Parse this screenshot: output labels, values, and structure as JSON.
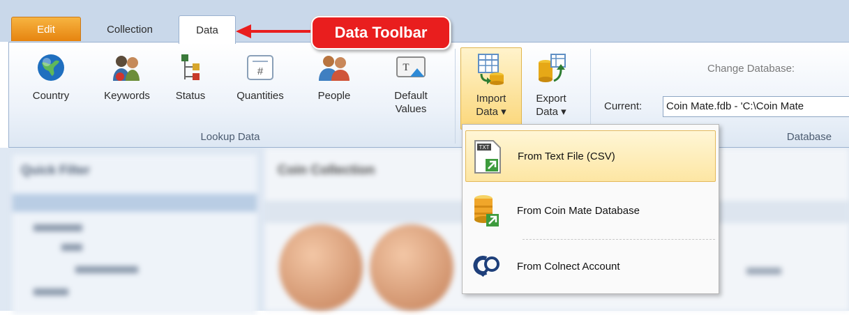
{
  "tabs": {
    "edit": "Edit",
    "collection": "Collection",
    "data": "Data"
  },
  "callout": "Data Toolbar",
  "lookup": {
    "buttons": [
      {
        "label": "Country"
      },
      {
        "label": "Keywords"
      },
      {
        "label": "Status"
      },
      {
        "label": "Quantities"
      },
      {
        "label": "People"
      },
      {
        "label1": "Default",
        "label2": "Values"
      }
    ],
    "group_label": "Lookup Data"
  },
  "import": {
    "label1": "Import",
    "label2": "Data ▾"
  },
  "export": {
    "label1": "Export",
    "label2": "Data ▾"
  },
  "database": {
    "change_label": "Change Database:",
    "current_label": "Current:",
    "current_value": "Coin Mate.fdb - 'C:\\Coin Mate",
    "group_label": "Database"
  },
  "import_menu": {
    "items": [
      {
        "label": "From Text File (CSV)",
        "icon": "csv-text-file-icon"
      },
      {
        "label": "From Coin Mate Database",
        "icon": "database-import-icon"
      },
      {
        "label": "From Colnect Account",
        "icon": "colnect-icon"
      }
    ]
  },
  "background": {
    "left_title": "Quick Filter",
    "right_title": "Coin Collection"
  },
  "colors": {
    "accent": "#e91e1e",
    "edit_tab": "#f0a030",
    "highlight": "#fde6a3"
  }
}
